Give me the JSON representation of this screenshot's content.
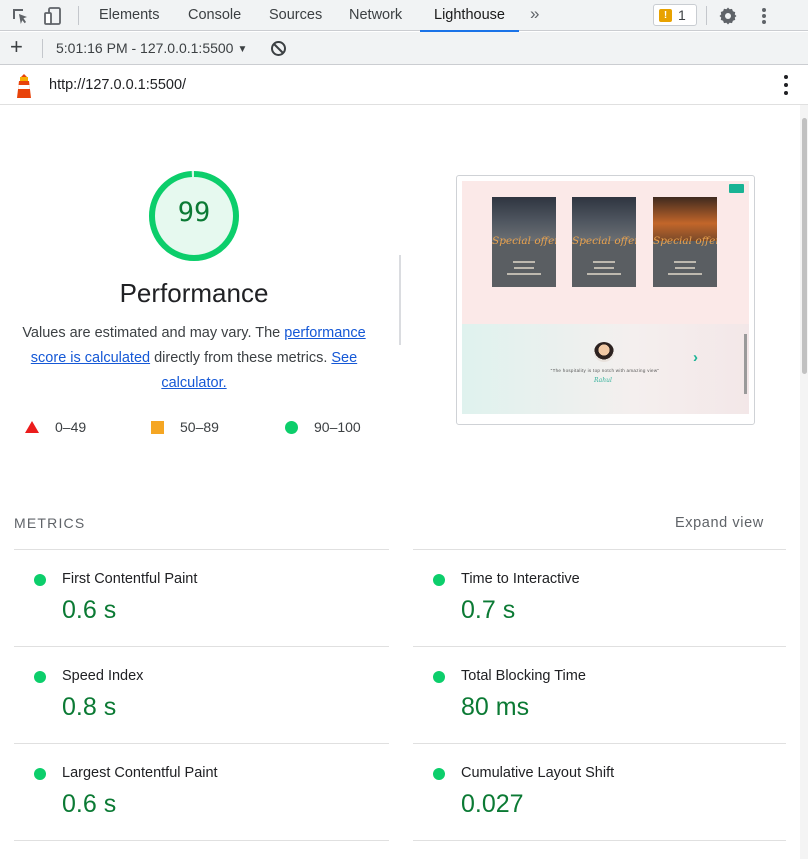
{
  "devtools": {
    "tabs": [
      "Elements",
      "Console",
      "Sources",
      "Network",
      "Lighthouse"
    ],
    "active_tab": "Lighthouse",
    "more_tabs_icon": "double-chevron-right-icon",
    "issues_count": "1"
  },
  "toolbar": {
    "add_icon": "plus-icon",
    "report_label": "5:01:16 PM - 127.0.0.1:5500",
    "clear_icon": "block-icon"
  },
  "report": {
    "url": "http://127.0.0.1:5500/"
  },
  "performance": {
    "score": "99",
    "score_fraction": 0.99,
    "title": "Performance",
    "desc_1": "Values are estimated and may vary. The ",
    "link_1": "performance score is calculated",
    "desc_2": " directly from these metrics. ",
    "link_2": "See calculator.",
    "legend": [
      {
        "range": "0–49",
        "shape": "triangle",
        "color": "#eb1c1c"
      },
      {
        "range": "50–89",
        "shape": "square",
        "color": "#f5a623"
      },
      {
        "range": "90–100",
        "shape": "circle",
        "color": "#0cce6b"
      }
    ],
    "ring_color": "#0cce6b",
    "score_color": "#0b7a34"
  },
  "screenshot": {
    "card_titles": [
      "Special offers",
      "Special offers",
      "Special offers"
    ],
    "testimonial": "\"The hospitality is top notch with amazing view\"",
    "testimonial_author": "Rahul"
  },
  "metrics": {
    "heading": "METRICS",
    "expand_label": "Expand view",
    "items": [
      {
        "name": "First Contentful Paint",
        "value": "0.6 s"
      },
      {
        "name": "Time to Interactive",
        "value": "0.7 s"
      },
      {
        "name": "Speed Index",
        "value": "0.8 s"
      },
      {
        "name": "Total Blocking Time",
        "value": "80 ms"
      },
      {
        "name": "Largest Contentful Paint",
        "value": "0.6 s"
      },
      {
        "name": "Cumulative Layout Shift",
        "value": "0.027"
      }
    ]
  }
}
